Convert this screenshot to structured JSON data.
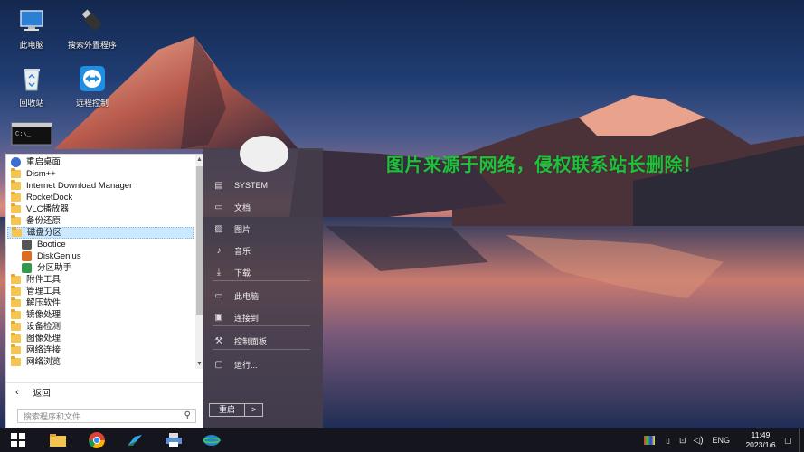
{
  "desktop": {
    "icons": [
      {
        "label": "此电脑",
        "icon": "this-pc-icon"
      },
      {
        "label": "搜索外置程序",
        "icon": "usb-drive-icon"
      },
      {
        "label": "回收站",
        "icon": "recycle-bin-icon"
      },
      {
        "label": "远程控制",
        "icon": "teamviewer-icon"
      },
      {
        "icon": "cmd-icon"
      }
    ],
    "watermark": "图片来源于网络，侵权联系站长删除！"
  },
  "start_menu": {
    "tree": [
      {
        "label": "重启桌面",
        "type": "app",
        "color": "#3a6fd0"
      },
      {
        "label": "Dism++",
        "type": "folder"
      },
      {
        "label": "Internet Download Manager",
        "type": "folder"
      },
      {
        "label": "RocketDock",
        "type": "folder"
      },
      {
        "label": "VLC播放器",
        "type": "folder"
      },
      {
        "label": "备份还原",
        "type": "folder"
      },
      {
        "label": "磁盘分区",
        "type": "folder",
        "selected": true
      },
      {
        "label": "Bootice",
        "type": "app",
        "sub": true,
        "color": "#555555"
      },
      {
        "label": "DiskGenius",
        "type": "app",
        "sub": true,
        "color": "#e06a1e"
      },
      {
        "label": "分区助手",
        "type": "app",
        "sub": true,
        "color": "#2e9a4a"
      },
      {
        "label": "附件工具",
        "type": "folder"
      },
      {
        "label": "管理工具",
        "type": "folder"
      },
      {
        "label": "解压软件",
        "type": "folder"
      },
      {
        "label": "镜像处理",
        "type": "folder"
      },
      {
        "label": "设备检测",
        "type": "folder"
      },
      {
        "label": "图像处理",
        "type": "folder"
      },
      {
        "label": "网络连接",
        "type": "folder"
      },
      {
        "label": "网络浏览",
        "type": "folder"
      }
    ],
    "back_label": "返回",
    "search_placeholder": "搜索程序和文件",
    "right_items": [
      {
        "label": "SYSTEM",
        "icon": "user-folder-icon",
        "glyph": "▤"
      },
      {
        "label": "文档",
        "icon": "documents-icon",
        "glyph": "▭"
      },
      {
        "label": "图片",
        "icon": "pictures-icon",
        "glyph": "▨"
      },
      {
        "label": "音乐",
        "icon": "music-icon",
        "glyph": "♪"
      },
      {
        "label": "下载",
        "icon": "downloads-icon",
        "glyph": "⤓"
      },
      {
        "label": "此电脑",
        "icon": "computer-icon",
        "glyph": "▭"
      },
      {
        "label": "连接到",
        "icon": "connect-icon",
        "glyph": "▣"
      },
      {
        "label": "控制面板",
        "icon": "wrench-icon",
        "glyph": "⚒"
      },
      {
        "label": "运行...",
        "icon": "run-icon",
        "glyph": "▢"
      }
    ],
    "restart_label": "重启",
    "restart_more": ">"
  },
  "taskbar": {
    "apps": [
      "start-icon",
      "explorer-folder-icon",
      "chrome-icon",
      "bird-app-icon",
      "printer-icon",
      "network-globe-icon"
    ],
    "tray": {
      "language": "ENG"
    },
    "clock": {
      "time": "11:49",
      "date": "2023/1/6"
    }
  }
}
